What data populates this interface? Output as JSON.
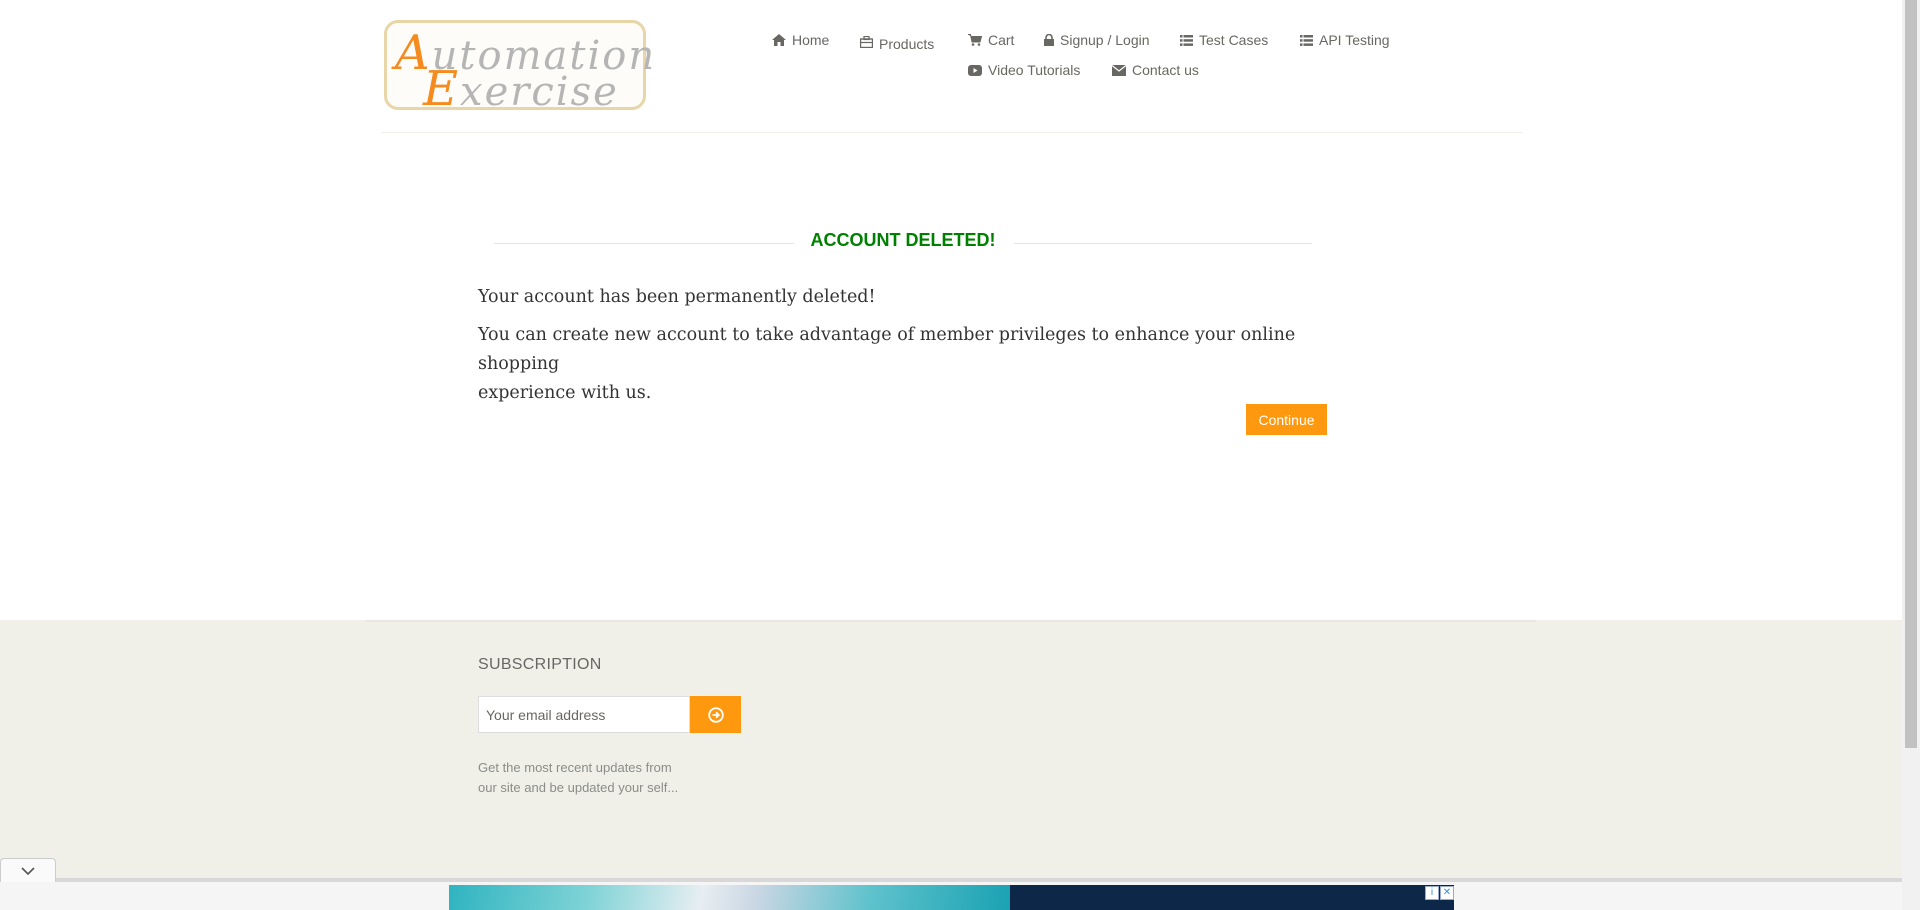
{
  "header": {
    "logo": {
      "line1_cap": "A",
      "line1_rest": "utomation",
      "line2_cap": "E",
      "line2_rest": "xercise"
    },
    "nav": [
      {
        "label": "Home",
        "icon": "home-icon"
      },
      {
        "label": "Products",
        "icon": "products-icon"
      },
      {
        "label": "Cart",
        "icon": "cart-icon"
      },
      {
        "label": "Signup / Login",
        "icon": "lock-icon"
      },
      {
        "label": "Test Cases",
        "icon": "list-icon"
      },
      {
        "label": "API Testing",
        "icon": "list-icon"
      },
      {
        "label": "Video Tutorials",
        "icon": "youtube-icon"
      },
      {
        "label": "Contact us",
        "icon": "envelope-icon"
      }
    ]
  },
  "main": {
    "title": "ACCOUNT DELETED!",
    "message1": "Your account has been permanently deleted!",
    "message2_line1": "You can create new account to take advantage of member privileges to enhance your online shopping",
    "message2_line2": "experience with us.",
    "continue_label": "Continue"
  },
  "footer": {
    "subscription_title": "SUBSCRIPTION",
    "email_placeholder": "Your email address",
    "subscribe_text_line1": "Get the most recent updates from",
    "subscribe_text_line2": "our site and be updated your self..."
  },
  "colors": {
    "accent": "#fe980f",
    "title_green": "#008000",
    "footer_bg": "#f0f0e9"
  }
}
